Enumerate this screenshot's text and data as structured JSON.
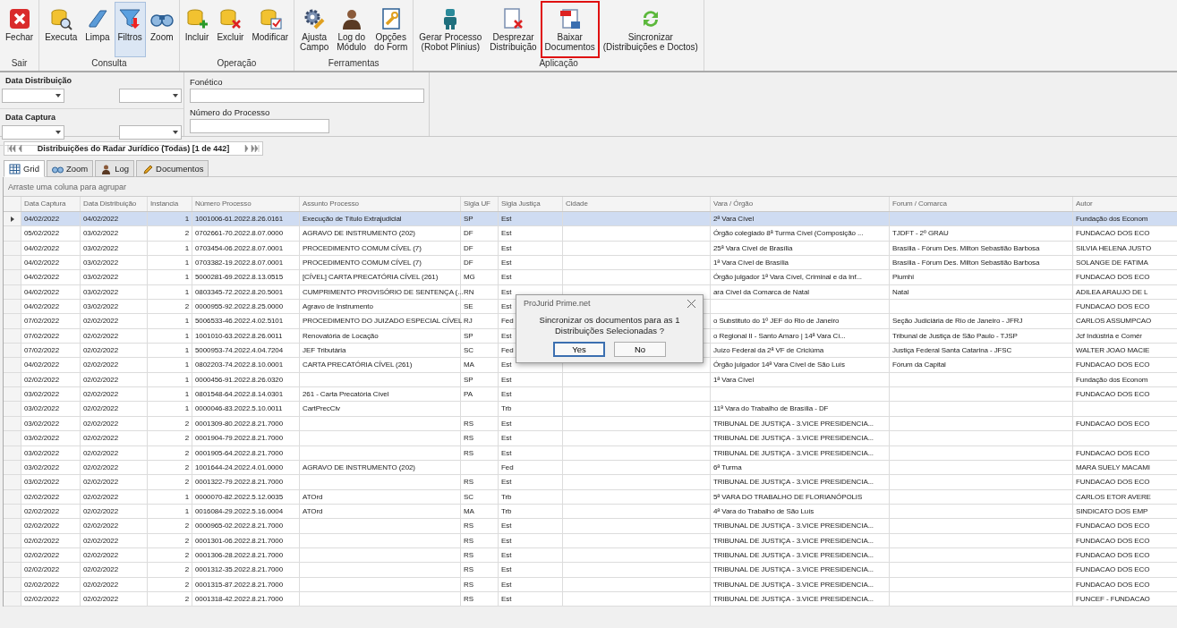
{
  "toolbar": {
    "groups": [
      {
        "label": "Sair",
        "buttons": [
          {
            "lines": [
              "Fechar"
            ],
            "selected": false,
            "highlighted": false
          }
        ]
      },
      {
        "label": "Consulta",
        "buttons": [
          {
            "lines": [
              "Executa"
            ],
            "selected": false,
            "highlighted": false
          },
          {
            "lines": [
              "Limpa"
            ],
            "selected": false,
            "highlighted": false
          },
          {
            "lines": [
              "Filtros"
            ],
            "selected": true,
            "highlighted": false
          },
          {
            "lines": [
              "Zoom"
            ],
            "selected": false,
            "highlighted": false
          }
        ]
      },
      {
        "label": "Operação",
        "buttons": [
          {
            "lines": [
              "Incluir"
            ],
            "selected": false,
            "highlighted": false
          },
          {
            "lines": [
              "Excluir"
            ],
            "selected": false,
            "highlighted": false
          },
          {
            "lines": [
              "Modificar"
            ],
            "selected": false,
            "highlighted": false
          }
        ]
      },
      {
        "label": "Ferramentas",
        "buttons": [
          {
            "lines": [
              "Ajusta",
              "Campo"
            ],
            "selected": false,
            "highlighted": false
          },
          {
            "lines": [
              "Log do",
              "Módulo"
            ],
            "selected": false,
            "highlighted": false
          },
          {
            "lines": [
              "Opções",
              "do Form"
            ],
            "selected": false,
            "highlighted": false
          }
        ]
      },
      {
        "label": "Aplicação",
        "buttons": [
          {
            "lines": [
              "Gerar Processo",
              "(Robot Plinius)"
            ],
            "selected": false,
            "highlighted": false
          },
          {
            "lines": [
              "Desprezar",
              "Distribuição"
            ],
            "selected": false,
            "highlighted": false
          },
          {
            "lines": [
              "Baixar",
              "Documentos"
            ],
            "selected": false,
            "highlighted": true
          },
          {
            "lines": [
              "Sincronizar",
              "(Distribuições e Doctos)"
            ],
            "selected": false,
            "highlighted": false
          }
        ]
      }
    ]
  },
  "filters": {
    "date_ranges": [
      {
        "label": "Data Distribuição"
      },
      {
        "label": "Data Captura"
      }
    ],
    "fields": [
      {
        "label": "Fonético"
      },
      {
        "label": "Número do Processo"
      }
    ]
  },
  "pager": {
    "text": "Distribuições do Radar Jurídico (Todas) [1 de 442]"
  },
  "tabs": [
    {
      "label": "Grid",
      "selected": true
    },
    {
      "label": "Zoom",
      "selected": false
    },
    {
      "label": "Log",
      "selected": false
    },
    {
      "label": "Documentos",
      "selected": false
    }
  ],
  "grid": {
    "group_hint": "Arraste uma coluna para agrupar",
    "columns": [
      {
        "label": "Data Captura",
        "kind": "text"
      },
      {
        "label": "Data Distribuição",
        "kind": "text"
      },
      {
        "label": "Instancia",
        "kind": "number"
      },
      {
        "label": "Número Processo",
        "kind": "text"
      },
      {
        "label": "Assunto Processo",
        "kind": "text"
      },
      {
        "label": "Sigla UF",
        "kind": "text"
      },
      {
        "label": "Sigla Justiça",
        "kind": "text"
      },
      {
        "label": "Cidade",
        "kind": "text"
      },
      {
        "label": "Vara / Órgão",
        "kind": "text"
      },
      {
        "label": "Forum / Comarca",
        "kind": "text"
      },
      {
        "label": "Autor",
        "kind": "text"
      }
    ],
    "rows": [
      {
        "selected": true,
        "cells": [
          "04/02/2022",
          "04/02/2022",
          "1",
          "1001006-61.2022.8.26.0161",
          "Execução de Título Extrajudicial",
          "SP",
          "Est",
          "",
          "2ª Vara Cível",
          "",
          "Fundação dos Econom"
        ]
      },
      {
        "selected": false,
        "cells": [
          "05/02/2022",
          "03/02/2022",
          "2",
          "0702661-70.2022.8.07.0000",
          "AGRAVO DE INSTRUMENTO (202)",
          "DF",
          "Est",
          "",
          "Órgão colegiado 8ª Turma Cível (Composição ...",
          "TJDFT - 2º GRAU",
          "FUNDACAO DOS ECO"
        ]
      },
      {
        "selected": false,
        "cells": [
          "04/02/2022",
          "03/02/2022",
          "1",
          "0703454-06.2022.8.07.0001",
          "PROCEDIMENTO COMUM CÍVEL (7)",
          "DF",
          "Est",
          "",
          "25ª Vara Cível de Brasília",
          "Brasília - Fórum Des. Milton Sebastião Barbosa",
          "SILVIA HELENA JUSTO"
        ]
      },
      {
        "selected": false,
        "cells": [
          "04/02/2022",
          "03/02/2022",
          "1",
          "0703382-19.2022.8.07.0001",
          "PROCEDIMENTO COMUM CÍVEL (7)",
          "DF",
          "Est",
          "",
          "1ª Vara Cível de Brasília",
          "Brasília - Fórum Des. Milton Sebastião Barbosa",
          "SOLANGE DE FATIMA"
        ]
      },
      {
        "selected": false,
        "cells": [
          "04/02/2022",
          "03/02/2022",
          "1",
          "5000281-69.2022.8.13.0515",
          "[CÍVEL] CARTA PRECATÓRIA CÍVEL (261)",
          "MG",
          "Est",
          "",
          "Órgão julgador 1ª Vara Cível, Criminal e da Inf...",
          "Piumhi",
          "FUNDACAO DOS ECO"
        ]
      },
      {
        "selected": false,
        "cells": [
          "04/02/2022",
          "03/02/2022",
          "1",
          "0803345-72.2022.8.20.5001",
          "CUMPRIMENTO PROVISÓRIO DE SENTENÇA (...",
          "RN",
          "Est",
          "",
          "ara Cível da Comarca de Natal",
          "Natal",
          "ADILEA ARAUJO DE L"
        ]
      },
      {
        "selected": false,
        "cells": [
          "04/02/2022",
          "03/02/2022",
          "2",
          "0000955-92.2022.8.25.0000",
          "Agravo de Instrumento",
          "SE",
          "Est",
          "",
          "",
          "",
          "FUNDACAO DOS ECO"
        ]
      },
      {
        "selected": false,
        "cells": [
          "07/02/2022",
          "02/02/2022",
          "1",
          "5006533-46.2022.4.02.5101",
          "PROCEDIMENTO DO JUIZADO ESPECIAL CÍVEL",
          "RJ",
          "Fed",
          "",
          "o Substituto do 1º JEF do Rio de Janeiro",
          "Seção Judiciária de Rio de Janeiro - JFRJ",
          "CARLOS ASSUMPCAO"
        ]
      },
      {
        "selected": false,
        "cells": [
          "07/02/2022",
          "02/02/2022",
          "1",
          "1001010-63.2022.8.26.0011",
          "Renovatória de Locação",
          "SP",
          "Est",
          "",
          "o Regional II - Santo Amaro |  14ª Vara Cí...",
          "Tribunal de Justiça de São Paulo - TJSP",
          "Jcf Indústria e Comér"
        ]
      },
      {
        "selected": false,
        "cells": [
          "07/02/2022",
          "02/02/2022",
          "1",
          "5000953-74.2022.4.04.7204",
          "JEF Tributária",
          "SC",
          "Fed",
          "",
          "Juízo Federal da 2ª VF de Criciúma",
          "Justiça Federal Santa Catarina - JFSC",
          "WALTER JOAO MACIE"
        ]
      },
      {
        "selected": false,
        "cells": [
          "04/02/2022",
          "02/02/2022",
          "1",
          "0802203-74.2022.8.10.0001",
          "CARTA PRECATÓRIA CÍVEL (261)",
          "MA",
          "Est",
          "",
          "Órgão julgador 14ª Vara Cível de São Luís",
          "Fórum da Capital",
          "FUNDACAO DOS ECO"
        ]
      },
      {
        "selected": false,
        "cells": [
          "02/02/2022",
          "02/02/2022",
          "1",
          "0000456-91.2022.8.26.0320",
          "",
          "SP",
          "Est",
          "",
          "1ª Vara Cível",
          "",
          "Fundação dos Econom"
        ]
      },
      {
        "selected": false,
        "cells": [
          "03/02/2022",
          "02/02/2022",
          "1",
          "0801548-64.2022.8.14.0301",
          "261 - Carta Precatória Cível",
          "PA",
          "Est",
          "",
          "",
          "",
          "FUNDACAO DOS ECO"
        ]
      },
      {
        "selected": false,
        "cells": [
          "03/02/2022",
          "02/02/2022",
          "1",
          "0000046-83.2022.5.10.0011",
          "CartPrecCiv",
          "",
          "Trb",
          "",
          "11ª Vara do Trabalho de Brasília - DF",
          "",
          ""
        ]
      },
      {
        "selected": false,
        "cells": [
          "03/02/2022",
          "02/02/2022",
          "2",
          "0001309-80.2022.8.21.7000",
          "",
          "RS",
          "Est",
          "",
          "TRIBUNAL DE JUSTIÇA - 3.VICE PRESIDENCIA...",
          "",
          "FUNDACAO DOS ECO"
        ]
      },
      {
        "selected": false,
        "cells": [
          "03/02/2022",
          "02/02/2022",
          "2",
          "0001904-79.2022.8.21.7000",
          "",
          "RS",
          "Est",
          "",
          "TRIBUNAL DE JUSTIÇA - 3.VICE PRESIDENCIA...",
          "",
          ""
        ]
      },
      {
        "selected": false,
        "cells": [
          "03/02/2022",
          "02/02/2022",
          "2",
          "0001905-64.2022.8.21.7000",
          "",
          "RS",
          "Est",
          "",
          "TRIBUNAL DE JUSTIÇA - 3.VICE PRESIDENCIA...",
          "",
          "FUNDACAO DOS ECO"
        ]
      },
      {
        "selected": false,
        "cells": [
          "03/02/2022",
          "02/02/2022",
          "2",
          "1001644-24.2022.4.01.0000",
          "AGRAVO DE INSTRUMENTO (202)",
          "",
          "Fed",
          "",
          "6ª Turma",
          "",
          "MARA SUELY MACAMI"
        ]
      },
      {
        "selected": false,
        "cells": [
          "03/02/2022",
          "02/02/2022",
          "2",
          "0001322-79.2022.8.21.7000",
          "",
          "RS",
          "Est",
          "",
          "TRIBUNAL DE JUSTIÇA - 3.VICE PRESIDENCIA...",
          "",
          "FUNDACAO DOS ECO"
        ]
      },
      {
        "selected": false,
        "cells": [
          "02/02/2022",
          "02/02/2022",
          "1",
          "0000070-82.2022.5.12.0035",
          "ATOrd",
          "SC",
          "Trb",
          "",
          "5ª VARA DO TRABALHO DE FLORIANÓPOLIS",
          "",
          "CARLOS ETOR AVERE"
        ]
      },
      {
        "selected": false,
        "cells": [
          "02/02/2022",
          "02/02/2022",
          "1",
          "0016084-29.2022.5.16.0004",
          "ATOrd",
          "MA",
          "Trb",
          "",
          "4ª Vara do Trabalho de São Luís",
          "",
          "SINDICATO DOS EMP"
        ]
      },
      {
        "selected": false,
        "cells": [
          "02/02/2022",
          "02/02/2022",
          "2",
          "0000965-02.2022.8.21.7000",
          "",
          "RS",
          "Est",
          "",
          "TRIBUNAL DE JUSTIÇA - 3.VICE PRESIDENCIA...",
          "",
          "FUNDACAO DOS ECO"
        ]
      },
      {
        "selected": false,
        "cells": [
          "02/02/2022",
          "02/02/2022",
          "2",
          "0001301-06.2022.8.21.7000",
          "",
          "RS",
          "Est",
          "",
          "TRIBUNAL DE JUSTIÇA - 3.VICE PRESIDENCIA...",
          "",
          "FUNDACAO DOS ECO"
        ]
      },
      {
        "selected": false,
        "cells": [
          "02/02/2022",
          "02/02/2022",
          "2",
          "0001306-28.2022.8.21.7000",
          "",
          "RS",
          "Est",
          "",
          "TRIBUNAL DE JUSTIÇA - 3.VICE PRESIDENCIA...",
          "",
          "FUNDACAO DOS ECO"
        ]
      },
      {
        "selected": false,
        "cells": [
          "02/02/2022",
          "02/02/2022",
          "2",
          "0001312-35.2022.8.21.7000",
          "",
          "RS",
          "Est",
          "",
          "TRIBUNAL DE JUSTIÇA - 3.VICE PRESIDENCIA...",
          "",
          "FUNDACAO DOS ECO"
        ]
      },
      {
        "selected": false,
        "cells": [
          "02/02/2022",
          "02/02/2022",
          "2",
          "0001315-87.2022.8.21.7000",
          "",
          "RS",
          "Est",
          "",
          "TRIBUNAL DE JUSTIÇA - 3.VICE PRESIDENCIA...",
          "",
          "FUNDACAO DOS ECO"
        ]
      },
      {
        "selected": false,
        "cells": [
          "02/02/2022",
          "02/02/2022",
          "2",
          "0001318-42.2022.8.21.7000",
          "",
          "RS",
          "Est",
          "",
          "TRIBUNAL DE JUSTIÇA - 3.VICE PRESIDENCIA...",
          "",
          "FUNCEF - FUNDACAO"
        ]
      }
    ]
  },
  "dialog": {
    "title": "ProJurid Prime.net",
    "message": "Sincronizar os documentos para as 1 Distribuições Selecionadas ?",
    "buttons": [
      {
        "label": "Yes",
        "selected": true
      },
      {
        "label": "No",
        "selected": false
      }
    ]
  }
}
